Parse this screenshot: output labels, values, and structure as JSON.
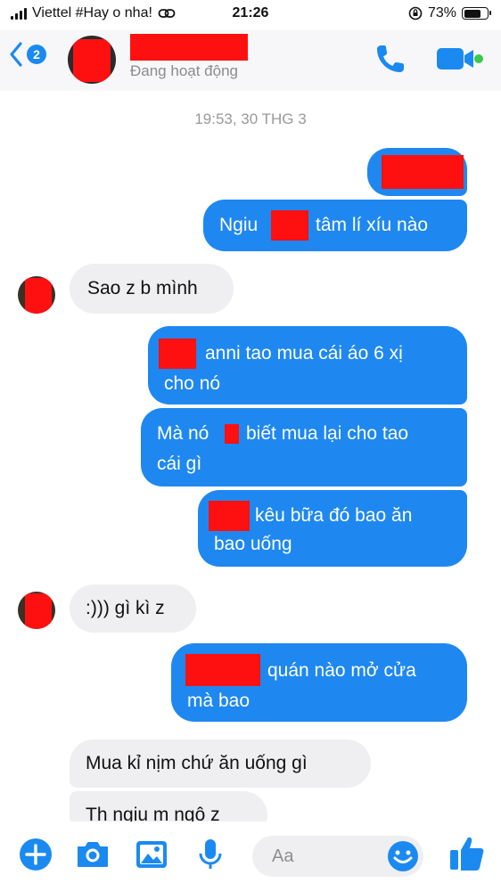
{
  "status_bar": {
    "carrier": "Viettel #Hay o nha!",
    "time": "21:26",
    "battery_percent": "73%",
    "battery_level": 0.73
  },
  "header": {
    "back_count": "2",
    "contact_status": "Đang hoạt động"
  },
  "chat": {
    "timestamp": "19:53, 30 THG 3",
    "messages": [
      {
        "from": "me",
        "text": ""
      },
      {
        "from": "me",
        "text_before": "Ngiu",
        "text_after": "tâm lí xíu nào"
      },
      {
        "from": "them",
        "text": "Sao z b mình"
      },
      {
        "from": "me",
        "line1": "anni tao mua cái áo 6 xị",
        "line2": "cho nó"
      },
      {
        "from": "me",
        "line1a": "Mà nó",
        "line1b": "biết mua lại cho tao",
        "line2": "cái gì"
      },
      {
        "from": "me",
        "line1": "kêu bữa đó bao ăn",
        "line2": "bao uống"
      },
      {
        "from": "them",
        "text": ":))) gì kì z"
      },
      {
        "from": "me",
        "line1": "quán nào mở cửa",
        "line2": "mà bao"
      },
      {
        "from": "them",
        "text": "Mua kỉ nịm chứ ăn uống gì"
      },
      {
        "from": "them",
        "text": "Th ngiu m ngô z"
      }
    ]
  },
  "composer": {
    "placeholder": "Aa"
  },
  "colors": {
    "accent": "#1e88f0",
    "incoming_bubble": "#efeff2",
    "redaction": "#ff1010",
    "online": "#3cc84a"
  },
  "icons": [
    "back-chevron-icon",
    "phone-icon",
    "video-camera-icon",
    "plus-icon",
    "camera-icon",
    "image-icon",
    "microphone-icon",
    "emoji-icon",
    "thumbs-up-icon"
  ]
}
